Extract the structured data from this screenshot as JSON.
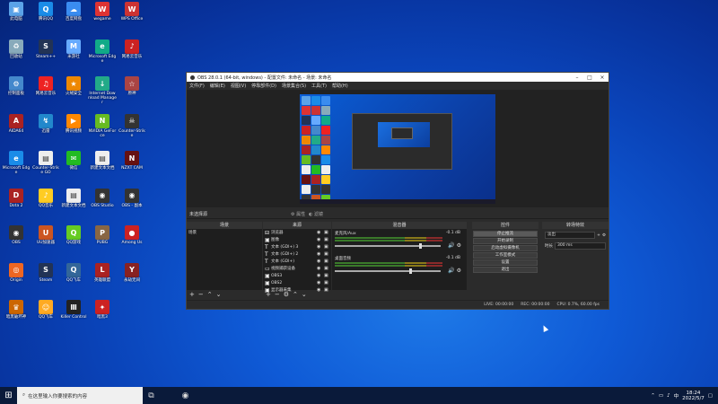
{
  "desktop": {
    "icons": [
      {
        "label": "此电脑",
        "color": "#5ba3e8",
        "glyph": "▣"
      },
      {
        "label": "腾讯QQ",
        "color": "#1a8ce8",
        "glyph": "Q"
      },
      {
        "label": "百度网盘",
        "color": "#3a8cf0",
        "glyph": "☁"
      },
      {
        "label": "wegame",
        "color": "#d33",
        "glyph": "W"
      },
      {
        "label": "WPS Office",
        "color": "#c33",
        "glyph": "W"
      },
      {
        "label": "回收站",
        "color": "#8ab",
        "glyph": "♻"
      },
      {
        "label": "Steam++",
        "color": "#235",
        "glyph": "S"
      },
      {
        "label": "米游社",
        "color": "#6af",
        "glyph": "M"
      },
      {
        "label": "Microsoft Edge",
        "color": "#1a8",
        "glyph": "e"
      },
      {
        "label": "网易云音乐",
        "color": "#c22",
        "glyph": "♪"
      },
      {
        "label": "控制面板",
        "color": "#48c",
        "glyph": "⚙"
      },
      {
        "label": "网易云音乐",
        "color": "#e22",
        "glyph": "♫"
      },
      {
        "label": "火绒安全",
        "color": "#e80",
        "glyph": "★"
      },
      {
        "label": "Internet Download Manager",
        "color": "#2a8",
        "glyph": "↓"
      },
      {
        "label": "原神",
        "color": "#a44",
        "glyph": "☆"
      },
      {
        "label": "AIDA64",
        "color": "#a22",
        "glyph": "A"
      },
      {
        "label": "迅雷",
        "color": "#28c",
        "glyph": "↯"
      },
      {
        "label": "腾讯视频",
        "color": "#f80",
        "glyph": "▶"
      },
      {
        "label": "NVIDIA GeForce",
        "color": "#6b2",
        "glyph": "N"
      },
      {
        "label": "Counter-Strike",
        "color": "#333",
        "glyph": "☠"
      },
      {
        "label": "Microsoft Edge",
        "color": "#1a8ce8",
        "glyph": "e"
      },
      {
        "label": "Counter-Strike GO",
        "color": "#eee",
        "glyph": "▤"
      },
      {
        "label": "微信",
        "color": "#2b2",
        "glyph": "✉"
      },
      {
        "label": "新建文本文档",
        "color": "#eee",
        "glyph": "▤"
      },
      {
        "label": "NZXT CAM",
        "color": "#611",
        "glyph": "N"
      },
      {
        "label": "Dota 2",
        "color": "#a22",
        "glyph": "D"
      },
      {
        "label": "QQ音乐",
        "color": "#fc2",
        "glyph": "♪"
      },
      {
        "label": "新建文本文档",
        "color": "#eee",
        "glyph": "▤"
      },
      {
        "label": "OBS Studio",
        "color": "#333",
        "glyph": "◉"
      },
      {
        "label": "OBS - 副本",
        "color": "#333",
        "glyph": "◉"
      },
      {
        "label": "OBS",
        "color": "#333",
        "glyph": "◉"
      },
      {
        "label": "UU加速器",
        "color": "#c52",
        "glyph": "U"
      },
      {
        "label": "QQ游戏",
        "color": "#6c2",
        "glyph": "Q"
      },
      {
        "label": "PUBG",
        "color": "#864",
        "glyph": "P"
      },
      {
        "label": "Among Us",
        "color": "#c22",
        "glyph": "●"
      },
      {
        "label": "Origin",
        "color": "#e62",
        "glyph": "◎"
      },
      {
        "label": "Steam",
        "color": "#235",
        "glyph": "S"
      },
      {
        "label": "QQ飞车",
        "color": "#369",
        "glyph": "Q"
      },
      {
        "label": "英雄联盟",
        "color": "#a22",
        "glyph": "L"
      },
      {
        "label": "永劫无间",
        "color": "#822",
        "glyph": "Y"
      },
      {
        "label": "暗黑破坏神",
        "color": "#c60",
        "glyph": "♛"
      },
      {
        "label": "QQ飞车",
        "color": "#fa2",
        "glyph": "☺"
      },
      {
        "label": "Killer Control",
        "color": "#222",
        "glyph": "Ⅲ"
      },
      {
        "label": "暗黑3",
        "color": "#c22",
        "glyph": "✦"
      }
    ]
  },
  "obs": {
    "title": "OBS 28.0.1 (64-bit, windows) - 配置文件: 未命名 - 场景: 未命名",
    "menu": [
      "文件(F)",
      "编辑(E)",
      "视图(V)",
      "停靠部件(D)",
      "场景集合(S)",
      "工具(T)",
      "帮助(H)"
    ],
    "scene_bar": {
      "label": "未选择源",
      "props": "属性",
      "filters": "滤镜"
    },
    "docks": {
      "scenes": {
        "title": "场景",
        "items": [
          "场景"
        ]
      },
      "sources": {
        "title": "来源",
        "items": [
          {
            "icon": "⊟",
            "name": "浏览器"
          },
          {
            "icon": "▣",
            "name": "图像"
          },
          {
            "icon": "T",
            "name": "文本 (GDI+) 3"
          },
          {
            "icon": "T",
            "name": "文本 (GDI+) 2"
          },
          {
            "icon": "T",
            "name": "文本 (GDI+)"
          },
          {
            "icon": "▭",
            "name": "视频捕获设备"
          },
          {
            "icon": "▣",
            "name": "OBS3"
          },
          {
            "icon": "▣",
            "name": "OBS2"
          },
          {
            "icon": "▣",
            "name": "显示器采集"
          }
        ]
      },
      "mixer": {
        "title": "混音器",
        "channels": [
          {
            "name": "麦克风/Aux",
            "db": "-0.1 dB",
            "level": 0.82
          },
          {
            "name": "桌面音频",
            "db": "-0.1 dB",
            "level": 0.72
          }
        ]
      },
      "controls": {
        "title": "控件",
        "buttons": [
          "停止推流",
          "开始录制",
          "启动虚拟摄像机",
          "工作室模式",
          "设置",
          "退出"
        ]
      },
      "transitions": {
        "title": "转场特效",
        "type": "淡出",
        "duration_label": "时长",
        "duration": "300 ms"
      }
    },
    "status": {
      "live": "LIVE: 00:00:00",
      "rec": "REC: 00:00:00",
      "cpu": "CPU: 0.7%, 60.00 fps"
    }
  },
  "taskbar": {
    "search_placeholder": "在这里输入你要搜索的内容",
    "time": "18:24",
    "date": "2022/5/7"
  }
}
